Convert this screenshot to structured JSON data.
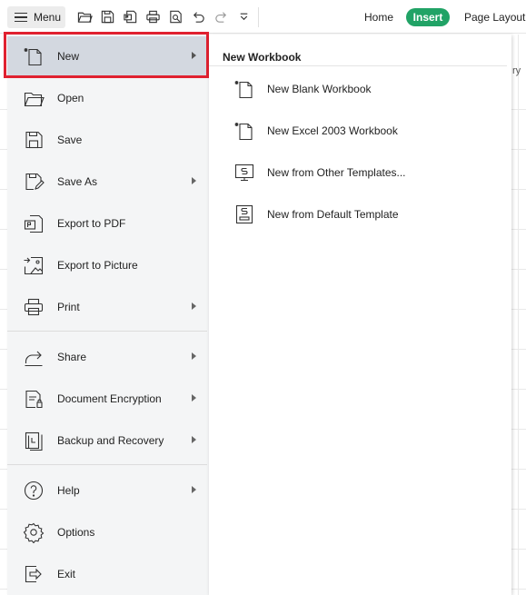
{
  "toolbar": {
    "menu_label": "Menu",
    "quick_icons": [
      "open-folder-icon",
      "save-icon",
      "export-pdf-icon",
      "print-icon",
      "print-preview-icon",
      "undo-icon",
      "redo-icon",
      "customize-chevron-icon"
    ],
    "tabs": [
      {
        "label": "Home",
        "active": false
      },
      {
        "label": "Insert",
        "active": true
      },
      {
        "label": "Page Layout",
        "active": false
      }
    ],
    "accent_color": "#21a366"
  },
  "menu": {
    "items": [
      {
        "label": "New",
        "icon": "new-file-icon",
        "has_submenu": true,
        "active": true
      },
      {
        "label": "Open",
        "icon": "open-folder-icon",
        "has_submenu": false
      },
      {
        "label": "Save",
        "icon": "save-icon",
        "has_submenu": false
      },
      {
        "label": "Save As",
        "icon": "save-as-icon",
        "has_submenu": true
      },
      {
        "label": "Export to PDF",
        "icon": "export-pdf-icon",
        "has_submenu": false
      },
      {
        "label": "Export to Picture",
        "icon": "export-picture-icon",
        "has_submenu": false
      },
      {
        "label": "Print",
        "icon": "print-icon",
        "has_submenu": true
      },
      {
        "label": "Share",
        "icon": "share-icon",
        "has_submenu": true
      },
      {
        "label": "Document Encryption",
        "icon": "document-encryption-icon",
        "has_submenu": true
      },
      {
        "label": "Backup and Recovery",
        "icon": "backup-icon",
        "has_submenu": true
      },
      {
        "label": "Help",
        "icon": "help-icon",
        "has_submenu": true
      },
      {
        "label": "Options",
        "icon": "gear-icon",
        "has_submenu": false
      },
      {
        "label": "Exit",
        "icon": "exit-icon",
        "has_submenu": false
      }
    ],
    "highlight_color": "#e02130"
  },
  "submenu": {
    "title": "New Workbook",
    "items": [
      {
        "label": "New Blank Workbook",
        "icon": "new-file-icon"
      },
      {
        "label": "New Excel 2003 Workbook",
        "icon": "new-file-icon"
      },
      {
        "label": "New from Other Templates...",
        "icon": "template-icon"
      },
      {
        "label": "New from Default Template",
        "icon": "default-template-icon"
      }
    ]
  },
  "background": {
    "partial_text": "ry"
  }
}
